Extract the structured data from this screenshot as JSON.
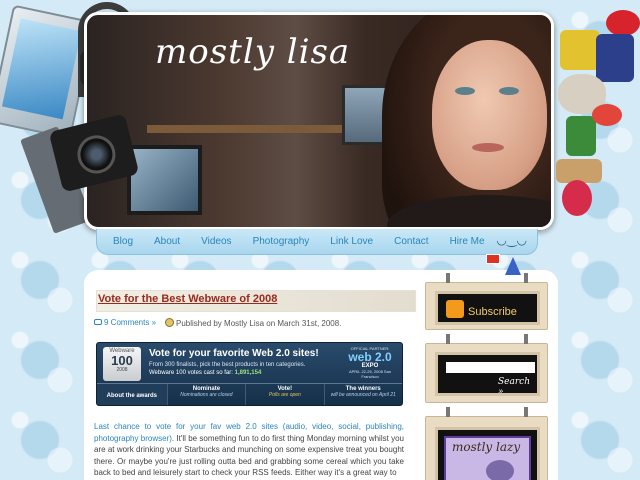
{
  "header": {
    "site_title": "mostly lisa"
  },
  "nav": {
    "items": [
      {
        "label": "Blog"
      },
      {
        "label": "About"
      },
      {
        "label": "Videos"
      },
      {
        "label": "Photography"
      },
      {
        "label": "Link Love"
      },
      {
        "label": "Contact"
      },
      {
        "label": "Hire Me"
      }
    ]
  },
  "post": {
    "title": "Vote for the Best Webware of 2008",
    "comments": "9 Comments »",
    "published": "Published by Mostly Lisa on March 31st, 2008.",
    "banner": {
      "badge_top": "Webware",
      "badge_num": "100",
      "badge_year": "2008",
      "headline": "Vote for your favorite Web 2.0 sites!",
      "subline": "From 300 finalists, pick the best products in ten categories.",
      "votes_prefix": "Webware 100 votes cast so far:",
      "votes_count": "1,891,154",
      "expo_partner": "OFFICIAL PARTNER:",
      "expo_big": "web 2.0",
      "expo_name": "EXPO",
      "expo_date": "APRIL 22-25, 2008 San Francisco",
      "cells": [
        {
          "title": "About the awards",
          "sub": ""
        },
        {
          "title": "Nominate",
          "sub": "Nominations are closed"
        },
        {
          "title": "Vote!",
          "sub": "Polls are open"
        },
        {
          "title": "The winners",
          "sub": "will be announced on April 21"
        }
      ]
    },
    "body_link": "Last chance to vote for your fav web 2.0 sites (audio, video, social, publishing, photography browser).",
    "body_text": " It'll be something fun to do first thing Monday morning whilst you are at work drinking your Starbucks and munching on some expensive treat you bought there. Or maybe you're just rolling outta bed and grabbing some cereal which you take back to bed and leisurely start to check your RSS feeds. Either way it's a great way to"
  },
  "sidebar": {
    "subscribe_label": "Subscribe",
    "search_label": "Search »",
    "logo_text": "mostly lazy"
  },
  "colors": {
    "background": "#d4eaf6",
    "nav_link": "#2a85bd",
    "post_title": "#9a2a1c",
    "rss_orange": "#f39a1d"
  }
}
